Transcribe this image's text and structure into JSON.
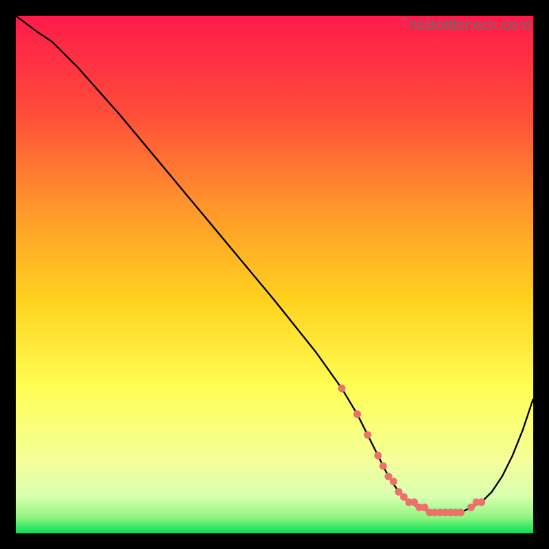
{
  "watermark": "TheBottleneck.com",
  "colors": {
    "gradient_top": "#ff1a4b",
    "gradient_mid_upper": "#ff7f2a",
    "gradient_mid": "#ffd21f",
    "gradient_mid_lower": "#ffff66",
    "gradient_pale": "#f7ffb3",
    "gradient_bottom": "#00e05a",
    "line": "#000000",
    "marker": "#ef6f6c",
    "bg": "#000000"
  },
  "chart_data": {
    "type": "line",
    "title": "",
    "xlabel": "",
    "ylabel": "",
    "xlim": [
      0,
      100
    ],
    "ylim": [
      0,
      100
    ],
    "series": [
      {
        "name": "curve",
        "x": [
          0,
          4,
          7,
          12,
          20,
          30,
          40,
          50,
          58,
          63,
          66,
          68,
          70,
          72,
          74,
          76,
          78,
          80,
          82,
          84,
          86,
          88,
          90,
          92,
          94,
          96,
          98,
          100
        ],
        "y": [
          100,
          97,
          95,
          90,
          81,
          69,
          57,
          45,
          35,
          28,
          23,
          19,
          15,
          11,
          8,
          6,
          5,
          4,
          4,
          4,
          4,
          5,
          6,
          8,
          11,
          15,
          20,
          26
        ]
      }
    ],
    "markers": {
      "name": "bottom-points",
      "x": [
        63,
        66,
        68,
        70,
        71,
        72,
        73,
        74,
        75,
        76,
        77,
        78,
        79,
        80,
        81,
        82,
        83,
        84,
        85,
        86,
        88,
        89,
        90
      ],
      "y": [
        28,
        23,
        19,
        15,
        13,
        11,
        10,
        8,
        7,
        6,
        6,
        5,
        5,
        4,
        4,
        4,
        4,
        4,
        4,
        4,
        5,
        6,
        6
      ]
    }
  }
}
